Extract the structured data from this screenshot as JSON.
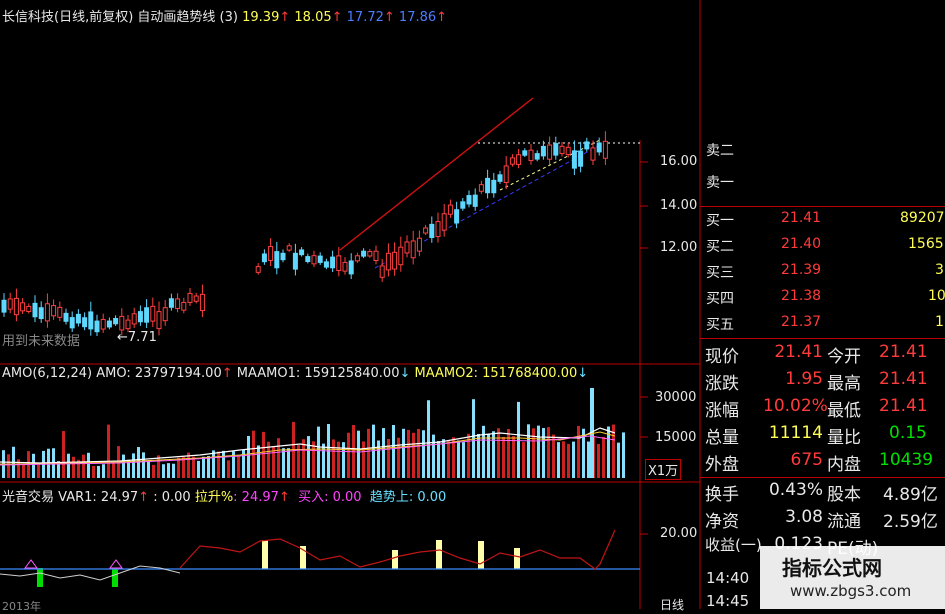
{
  "header": {
    "title": "长信科技(日线,前复权)",
    "indicator": "自动画趋势线 (3)",
    "values": [
      "19.39",
      "18.05",
      "17.72",
      "17.86"
    ]
  },
  "main_chart": {
    "price_axis": [
      "16.00",
      "14.00",
      "12.00"
    ],
    "low_label": "←7.71",
    "note": "用到未来数据"
  },
  "orderbook": {
    "sell_labels": [
      "卖二",
      "卖一"
    ],
    "buy": [
      {
        "label": "买一",
        "price": "21.41",
        "vol": "89207"
      },
      {
        "label": "买二",
        "price": "21.40",
        "vol": "1565"
      },
      {
        "label": "买三",
        "price": "21.39",
        "vol": "3"
      },
      {
        "label": "买四",
        "price": "21.38",
        "vol": "10"
      },
      {
        "label": "买五",
        "price": "21.37",
        "vol": "1"
      }
    ]
  },
  "volume_panel": {
    "legend": "AMO(6,12,24)",
    "amo": "AMO: 23797194.00",
    "maamo1": "MAAMO1: 159125840.00",
    "maamo2": "MAAMO2: 151768400.00",
    "axis": [
      "30000",
      "15000"
    ],
    "unit": "X1万"
  },
  "quotes": [
    {
      "l1": "现价",
      "v1": "21.41",
      "l2": "今开",
      "v2": "21.41"
    },
    {
      "l1": "涨跌",
      "v1": "1.95",
      "l2": "最高",
      "v2": "21.41"
    },
    {
      "l1": "涨幅",
      "v1": "10.02%",
      "l2": "最低",
      "v2": "21.41"
    },
    {
      "l1": "总量",
      "v1": "11114",
      "l2": "量比",
      "v2": "0.15"
    },
    {
      "l1": "外盘",
      "v1": "675",
      "l2": "内盘",
      "v2": "10439"
    },
    {
      "l1": "换手",
      "v1": "0.43%",
      "l2": "股本",
      "v2": "4.89亿"
    },
    {
      "l1": "净资",
      "v1": "3.08",
      "l2": "流通",
      "v2": "2.59亿"
    },
    {
      "l1": "收益(一)",
      "v1": "0.123",
      "l2": "PE(动)",
      "v2": ""
    }
  ],
  "indicator_panel": {
    "name": "光音交易",
    "var1": "VAR1: 24.97",
    "zero": ": 0.00",
    "lashen": "拉升%",
    "lashen_val": ": 24.97",
    "buy": "买入: 0.00",
    "trend": "趋势上: 0.00",
    "axis": "20.00"
  },
  "time_rows": [
    "14:40",
    "14:45"
  ],
  "watermark": {
    "cn": "指标公式网",
    "url": "www.zbgs3.com"
  },
  "bottom": {
    "date_left": "2013年",
    "right_label": "日线"
  }
}
